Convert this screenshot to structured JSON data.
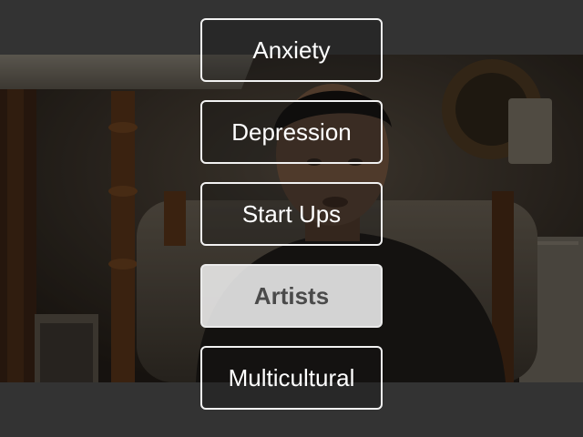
{
  "menu": {
    "items": [
      {
        "label": "Anxiety",
        "selected": false
      },
      {
        "label": "Depression",
        "selected": false
      },
      {
        "label": "Start Ups",
        "selected": false
      },
      {
        "label": "Artists",
        "selected": true
      },
      {
        "label": "Multicultural",
        "selected": false
      }
    ]
  },
  "colors": {
    "letterbox": "#333333",
    "button_border": "#f2f2f2",
    "selected_background": "#eeeeee",
    "selected_text": "#4a4a4a"
  }
}
